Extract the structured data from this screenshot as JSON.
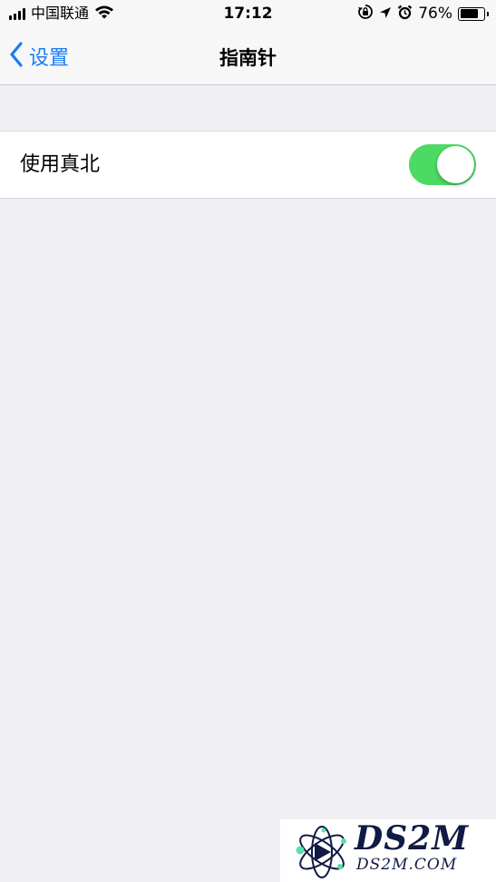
{
  "status_bar": {
    "carrier": "中国联通",
    "time": "17:12",
    "battery_percent_text": "76%",
    "battery_level": 0.76,
    "icons": [
      "signal-icon",
      "wifi-icon",
      "orientation-lock-icon",
      "location-icon",
      "alarm-icon",
      "battery-icon"
    ]
  },
  "nav": {
    "back_label": "设置",
    "title": "指南针"
  },
  "settings": {
    "rows": [
      {
        "label": "使用真北",
        "toggle_on": true
      }
    ]
  },
  "watermark": {
    "brand": "DS2M",
    "site": "DS2M.COM"
  },
  "colors": {
    "accent": "#1a7cf5",
    "toggle_on": "#4cd964",
    "background": "#efeff4",
    "bar_background": "#f7f7f7"
  }
}
